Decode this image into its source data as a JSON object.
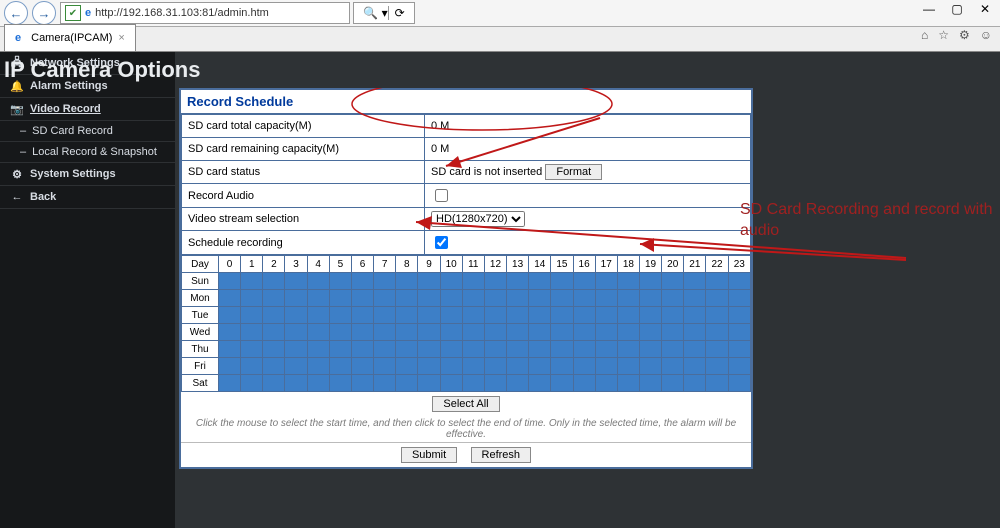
{
  "window": {
    "url": "http://192.168.31.103:81/admin.htm",
    "tab_title": "Camera(IPCAM)"
  },
  "header": {
    "title": "IP Camera Options"
  },
  "sidebar": {
    "items": [
      {
        "label": "Network Settings",
        "icon": "🖧"
      },
      {
        "label": "Alarm Settings",
        "icon": "🔔"
      },
      {
        "label": "Video Record",
        "icon": "📷",
        "active": true
      },
      {
        "label": "SD Card Record",
        "sub": true,
        "prefix": "–"
      },
      {
        "label": "Local Record & Snapshot",
        "sub": true,
        "prefix": "–"
      },
      {
        "label": "System Settings",
        "icon": "⚙"
      },
      {
        "label": "Back",
        "icon": "←"
      }
    ]
  },
  "panel": {
    "section_title": "Record Schedule",
    "rows": [
      {
        "label": "SD card total capacity(M)",
        "value": "0 M"
      },
      {
        "label": "SD card remaining capacity(M)",
        "value": "0 M"
      },
      {
        "label": "SD card status",
        "value": "SD card is not inserted",
        "button": "Format"
      },
      {
        "label": "Record Audio",
        "checkbox": false
      },
      {
        "label": "Video stream selection",
        "select": "HD(1280x720)"
      },
      {
        "label": "Schedule recording",
        "checkbox": true
      }
    ],
    "schedule": {
      "day_header": "Day",
      "hours": [
        "0",
        "1",
        "2",
        "3",
        "4",
        "5",
        "6",
        "7",
        "8",
        "9",
        "10",
        "11",
        "12",
        "13",
        "14",
        "15",
        "16",
        "17",
        "18",
        "19",
        "20",
        "21",
        "22",
        "23"
      ],
      "days": [
        "Sun",
        "Mon",
        "Tue",
        "Wed",
        "Thu",
        "Fri",
        "Sat"
      ]
    },
    "select_all": "Select All",
    "help": "Click the mouse to select the start time, and then click to select the end of time. Only in the selected time, the alarm will be effective.",
    "submit": "Submit",
    "refresh": "Refresh"
  },
  "annotation": "SD Card Recording and record with audio"
}
